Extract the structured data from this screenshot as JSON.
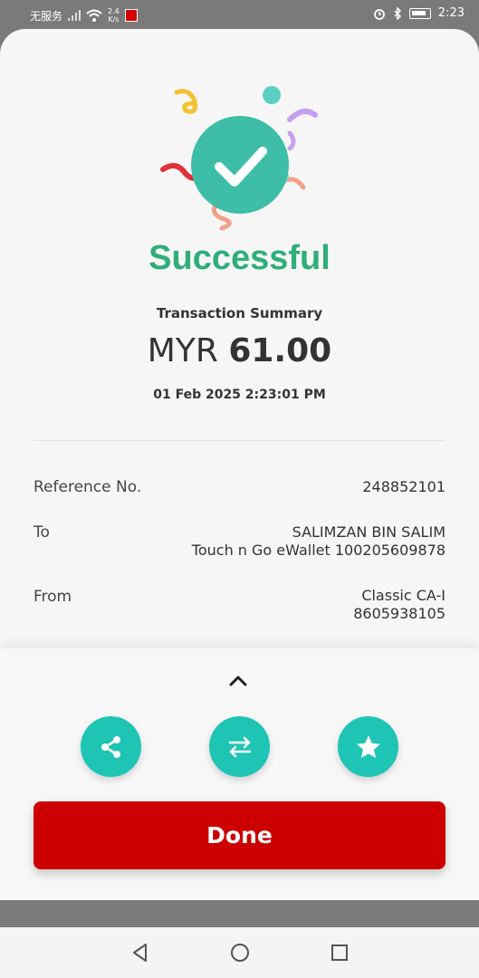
{
  "status_bar": {
    "carrier": "无服务",
    "speed_value": "2.4",
    "speed_unit": "K/s",
    "time": "2:23"
  },
  "result": {
    "title": "Successful",
    "summary_label": "Transaction Summary",
    "currency": "MYR",
    "amount": "61.00",
    "datetime": "01 Feb 2025 2:23:01 PM"
  },
  "details": {
    "reference_label": "Reference No.",
    "reference_value": "248852101",
    "to_label": "To",
    "to_name": "SALIMZAN BIN SALIM",
    "to_account": "Touch n Go eWallet 100205609878",
    "from_label": "From",
    "from_name": "Classic  CA-I",
    "from_account": "8605938105"
  },
  "actions": {
    "icons": [
      "share-icon",
      "transfer-icon",
      "star-icon"
    ],
    "done_label": "Done"
  },
  "colors": {
    "success": "#2fae78",
    "accent_teal": "#1ec4b4",
    "primary_red": "#cc0000"
  }
}
